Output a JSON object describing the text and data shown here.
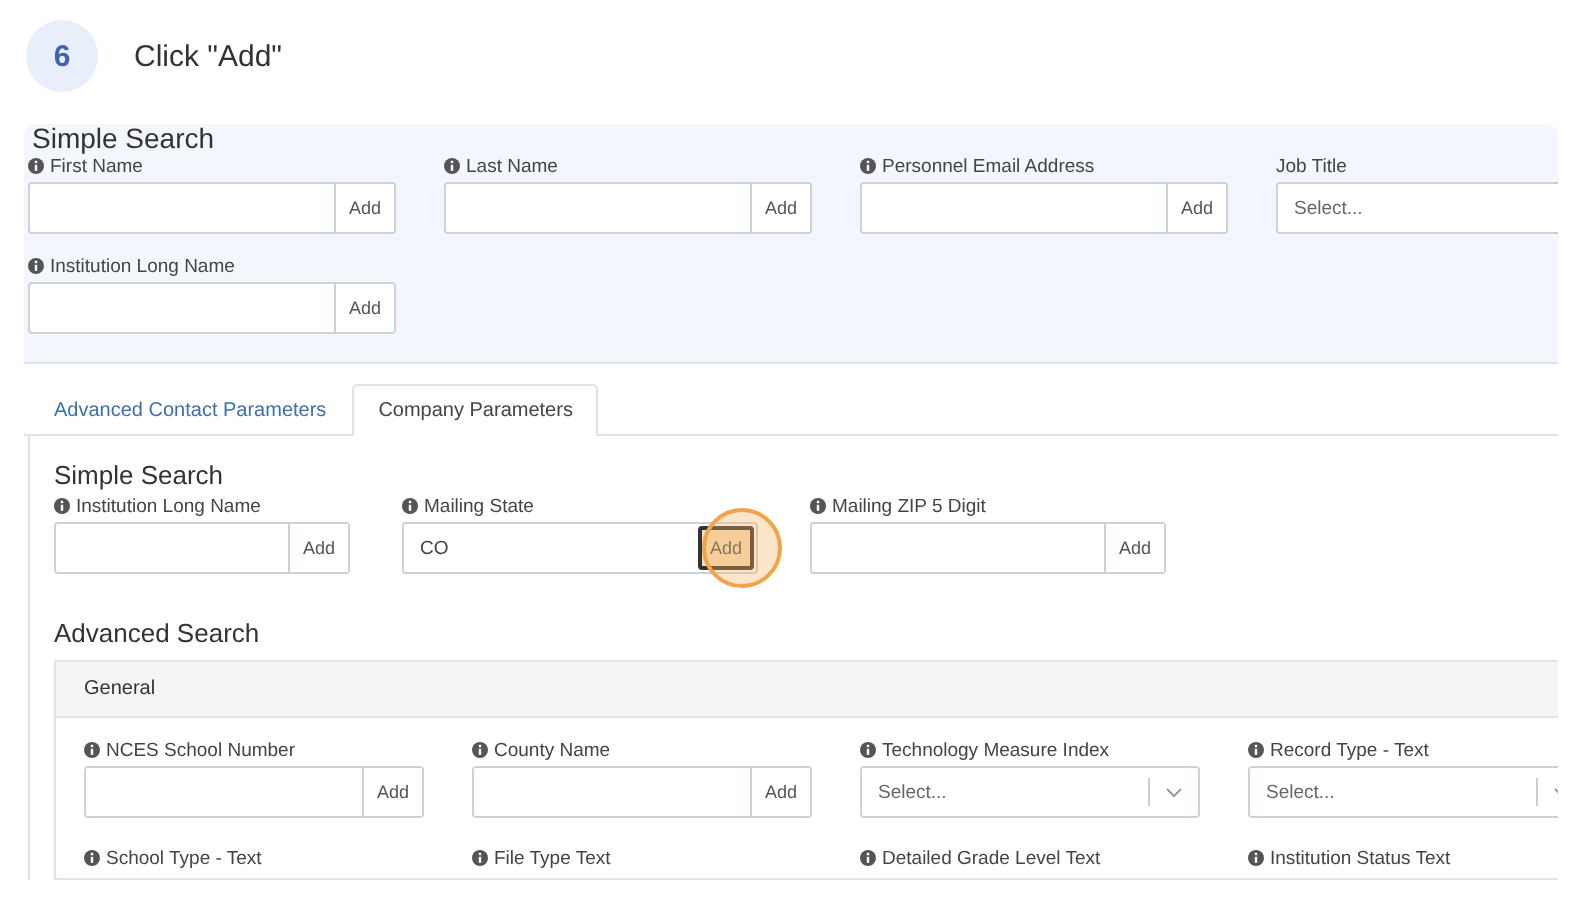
{
  "step": {
    "number": "6",
    "instruction": "Click \"Add\""
  },
  "contact_search": {
    "heading": "Simple Search",
    "fields": [
      {
        "kind": "text",
        "label": "First Name",
        "info": true,
        "button": "Add",
        "highlighted": false
      },
      {
        "kind": "text",
        "label": "Last Name",
        "info": true,
        "button": "Add",
        "highlighted": false
      },
      {
        "kind": "text",
        "label": "Personnel Email Address",
        "info": true,
        "button": "Add",
        "highlighted": false
      },
      {
        "kind": "select",
        "label": "Job Title",
        "info": false,
        "placeholder": "Select..."
      },
      {
        "kind": "text",
        "label": "Institution Long Name",
        "info": true,
        "button": "Add",
        "highlighted": false
      }
    ]
  },
  "tabs": [
    {
      "label": "Advanced Contact Parameters",
      "selected": false
    },
    {
      "label": "Company Parameters",
      "selected": true
    }
  ],
  "company_search": {
    "heading": "Simple Search",
    "fields": [
      {
        "kind": "text",
        "label": "Institution Long Name",
        "info": true,
        "button": "Add",
        "highlighted": false
      },
      {
        "kind": "text",
        "label": "Mailing State",
        "info": true,
        "value": "CO",
        "button": "Add",
        "highlighted": true
      },
      {
        "kind": "text",
        "label": "Mailing ZIP 5 Digit",
        "info": true,
        "button": "Add",
        "highlighted": false
      }
    ]
  },
  "advanced_search": {
    "heading": "Advanced Search",
    "section": {
      "title": "General",
      "fields": [
        {
          "kind": "text",
          "label": "NCES School Number",
          "info": true,
          "button": "Add",
          "highlighted": false
        },
        {
          "kind": "text",
          "label": "County Name",
          "info": true,
          "button": "Add",
          "highlighted": false
        },
        {
          "kind": "select",
          "label": "Technology Measure Index",
          "info": true,
          "placeholder": "Select..."
        },
        {
          "kind": "select",
          "label": "Record Type - Text",
          "info": true,
          "placeholder": "Select..."
        },
        {
          "kind": "label",
          "label": "School Type - Text",
          "info": true
        },
        {
          "kind": "label",
          "label": "File Type Text",
          "info": true
        },
        {
          "kind": "label",
          "label": "Detailed Grade Level Text",
          "info": true
        },
        {
          "kind": "label",
          "label": "Institution Status Text",
          "info": true
        }
      ]
    }
  }
}
